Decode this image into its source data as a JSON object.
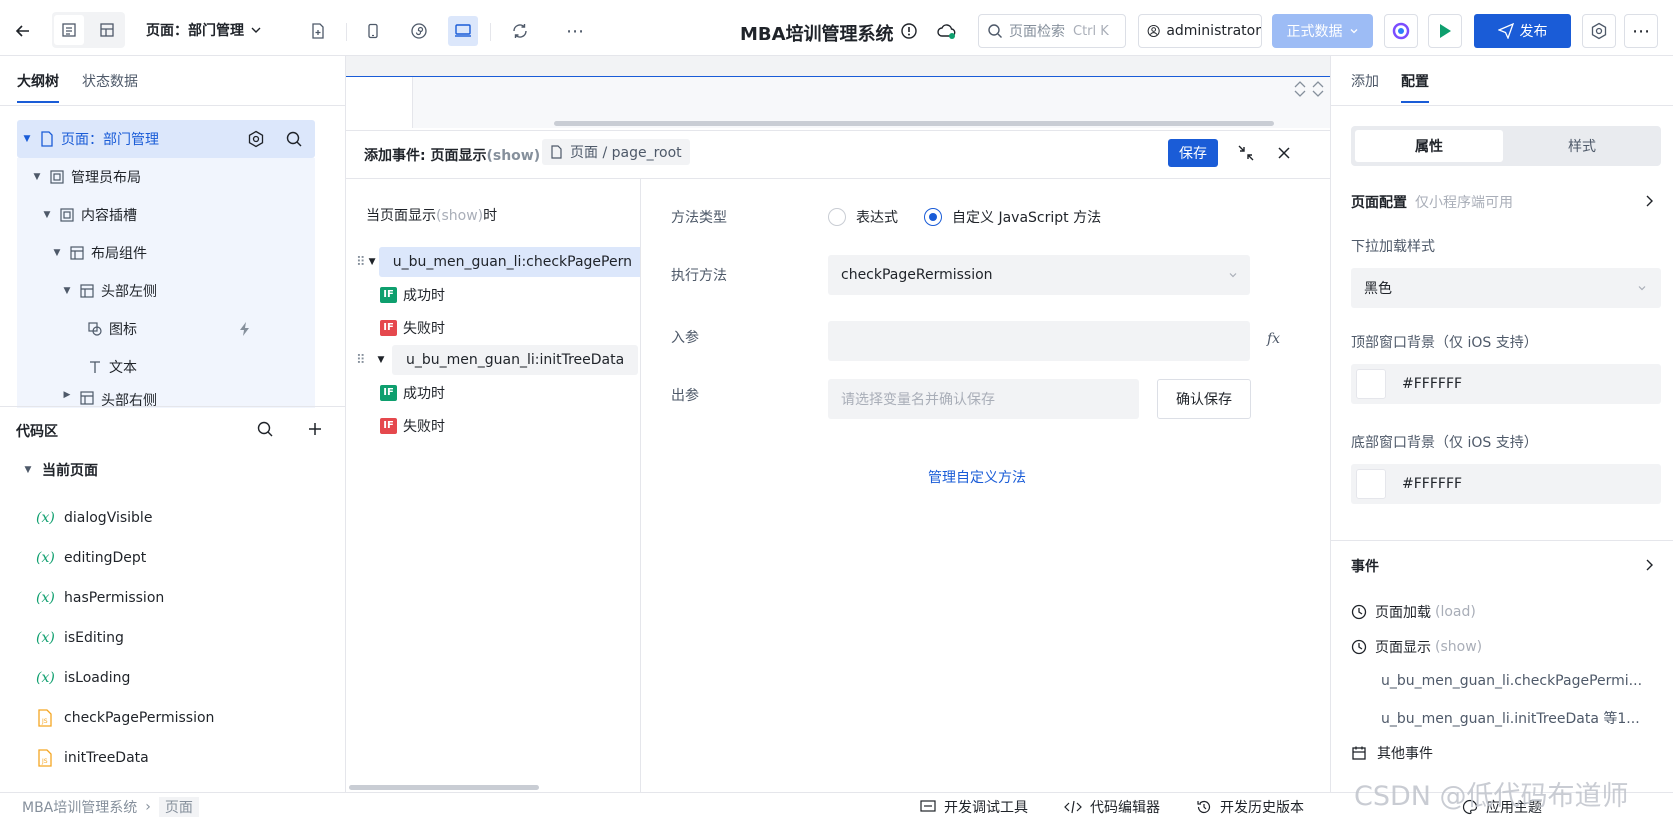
{
  "topbar": {
    "page_selector": "页面：部门管理",
    "app_title": "MBA培训管理系统",
    "search": {
      "placeholder": "页面检索",
      "shortcut": "Ctrl K"
    },
    "user": "administrator",
    "data_mode": "正式数据",
    "publish": "发布"
  },
  "left": {
    "tabs": [
      "大纲树",
      "状态数据"
    ],
    "tree": [
      {
        "label": "页面：部门管理"
      },
      {
        "label": "管理员布局"
      },
      {
        "label": "内容插槽"
      },
      {
        "label": "布局组件"
      },
      {
        "label": "头部左侧"
      },
      {
        "label": "图标"
      },
      {
        "label": "文本"
      },
      {
        "label": "头部右侧"
      }
    ],
    "code_area_title": "代码区",
    "current_page_label": "当前页面",
    "code_items": [
      {
        "label": "dialogVisible",
        "kind": "variable",
        "icon": "(x)"
      },
      {
        "label": "editingDept",
        "kind": "variable",
        "icon": "(x)"
      },
      {
        "label": "hasPermission",
        "kind": "variable",
        "icon": "(x)"
      },
      {
        "label": "isEditing",
        "kind": "variable",
        "icon": "(x)"
      },
      {
        "label": "isLoading",
        "kind": "variable",
        "icon": "(x)"
      },
      {
        "label": "checkPagePermission",
        "kind": "js"
      },
      {
        "label": "initTreeData",
        "kind": "js"
      }
    ]
  },
  "dialog": {
    "title": "添加事件: 页面显示",
    "title_event": "(show)",
    "breadcrumb": "页面 / page_root",
    "save": "保存",
    "when_prefix": "当页面显示",
    "when_event": "(show)",
    "when_suffix": "时",
    "actions": [
      {
        "label": "u_bu_men_guan_li:checkPagePern",
        "success": "成功时",
        "fail": "失败时"
      },
      {
        "label": "u_bu_men_guan_li:initTreeData",
        "success": "成功时",
        "fail": "失败时"
      }
    ],
    "if_badge": "IF",
    "form": {
      "method_type_label": "方法类型",
      "option_expression": "表达式",
      "option_custom": "自定义 JavaScript 方法",
      "exec_label": "执行方法",
      "exec_value": "checkPageRermission",
      "input_label": "入参",
      "fx": "fx",
      "output_label": "出参",
      "output_placeholder": "请选择变量名并确认保存",
      "confirm_save": "确认保存",
      "manage_link": "管理自定义方法"
    }
  },
  "right": {
    "tabs": [
      "添加",
      "配置"
    ],
    "segments": [
      "属性",
      "样式"
    ],
    "page_config": "页面配置",
    "page_config_note": "仅小程序端可用",
    "pull_style_label": "下拉加载样式",
    "pull_style_value": "黑色",
    "top_bg_label": "顶部窗口背景（仅 iOS 支持）",
    "top_bg_value": "#FFFFFF",
    "bottom_bg_label": "底部窗口背景（仅 iOS 支持）",
    "bottom_bg_value": "#FFFFFF",
    "events_title": "事件",
    "event_load": "页面加载",
    "event_load_key": "(load)",
    "event_show": "页面显示",
    "event_show_key": "(show)",
    "event_show_actions": [
      "u_bu_men_guan_li.checkPagePermi...",
      "u_bu_men_guan_li.initTreeData 等1..."
    ],
    "other_events": "其他事件"
  },
  "bottombar": {
    "breadcrumb": [
      "MBA培训管理系统",
      "页面"
    ],
    "dev_tools": "开发调试工具",
    "code_editor": "代码编辑器",
    "history": "开发历史版本",
    "theme": "应用主题",
    "watermark": "CSDN @低代码布道师"
  },
  "colors": {
    "accent": "#1a5cd7",
    "selected_bg": "#dce7fb",
    "field_bg": "#f2f3f5",
    "if_success": "#0e9f6e",
    "if_fail": "#e5484d",
    "var_icon": "#0e9f6e",
    "js_icon": "#f5a623"
  }
}
